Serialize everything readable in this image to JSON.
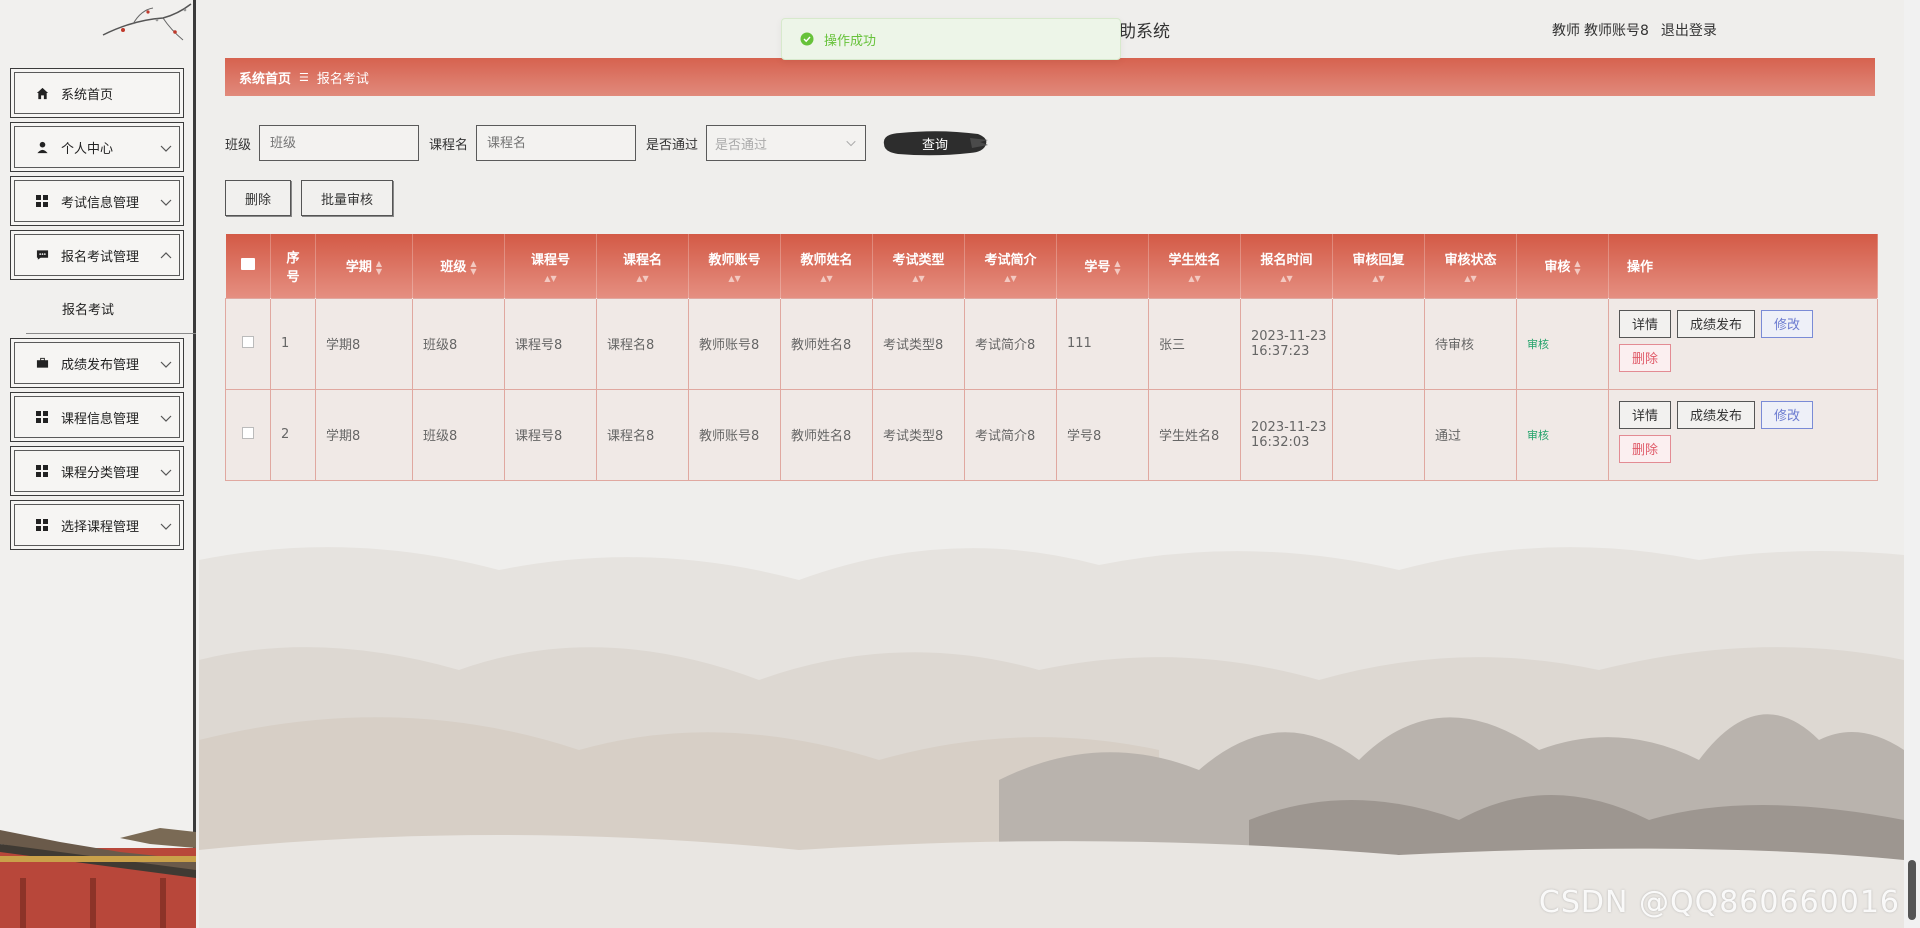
{
  "header": {
    "system_title": "助系统",
    "user_role": "教师",
    "user_account": "教师账号8",
    "logout_label": "退出登录"
  },
  "toast": {
    "message": "操作成功",
    "color": "#67c23a"
  },
  "breadcrumb": {
    "home": "系统首页",
    "separator": "☰",
    "current": "报名考试"
  },
  "sidebar": {
    "items": [
      {
        "label": "系统首页",
        "icon": "home-icon",
        "expandable": false
      },
      {
        "label": "个人中心",
        "icon": "user-icon",
        "expandable": true
      },
      {
        "label": "考试信息管理",
        "icon": "grid-icon",
        "expandable": true
      },
      {
        "label": "报名考试管理",
        "icon": "message-icon",
        "expandable": true,
        "expanded": true
      },
      {
        "label": "成绩发布管理",
        "icon": "briefcase-icon",
        "expandable": true
      },
      {
        "label": "课程信息管理",
        "icon": "grid-icon",
        "expandable": true
      },
      {
        "label": "课程分类管理",
        "icon": "grid-icon",
        "expandable": true
      },
      {
        "label": "选择课程管理",
        "icon": "grid-icon",
        "expandable": true
      }
    ],
    "subitem": "报名考试"
  },
  "search": {
    "class_label": "班级",
    "class_placeholder": "班级",
    "course_label": "课程名",
    "course_placeholder": "课程名",
    "passed_label": "是否通过",
    "passed_placeholder": "是否通过",
    "query_button": "查询"
  },
  "actions": {
    "delete": "删除",
    "batch_audit": "批量审核"
  },
  "table": {
    "headers": [
      "序号",
      "学期",
      "班级",
      "课程号",
      "课程名",
      "教师账号",
      "教师姓名",
      "考试类型",
      "考试简介",
      "学号",
      "学生姓名",
      "报名时间",
      "审核回复",
      "审核状态",
      "审核",
      "操作"
    ],
    "index_header_line1": "序",
    "index_header_line2": "号",
    "rows": [
      {
        "index": "1",
        "term": "学期8",
        "class": "班级8",
        "course_no": "课程号8",
        "course_name": "课程名8",
        "teacher_account": "教师账号8",
        "teacher_name": "教师姓名8",
        "exam_type": "考试类型8",
        "exam_intro": "考试简介8",
        "student_no": "111",
        "student_name": "张三",
        "signup_date": "2023-11-23",
        "signup_time": "16:37:23",
        "audit_reply": "",
        "audit_status": "待审核",
        "audit_link": "审核"
      },
      {
        "index": "2",
        "term": "学期8",
        "class": "班级8",
        "course_no": "课程号8",
        "course_name": "课程名8",
        "teacher_account": "教师账号8",
        "teacher_name": "教师姓名8",
        "exam_type": "考试类型8",
        "exam_intro": "考试简介8",
        "student_no": "学号8",
        "student_name": "学生姓名8",
        "signup_date": "2023-11-23",
        "signup_time": "16:32:03",
        "audit_reply": "",
        "audit_status": "通过",
        "audit_link": "审核"
      }
    ],
    "row_buttons": {
      "detail": "详情",
      "publish": "成绩发布",
      "edit": "修改",
      "delete": "删除"
    }
  },
  "watermark": "CSDN @QQ860660016",
  "colors": {
    "accent": "#d6624f",
    "audit_link": "#24a36b",
    "edit": "#6b7bd0",
    "delete": "#e05a68"
  }
}
